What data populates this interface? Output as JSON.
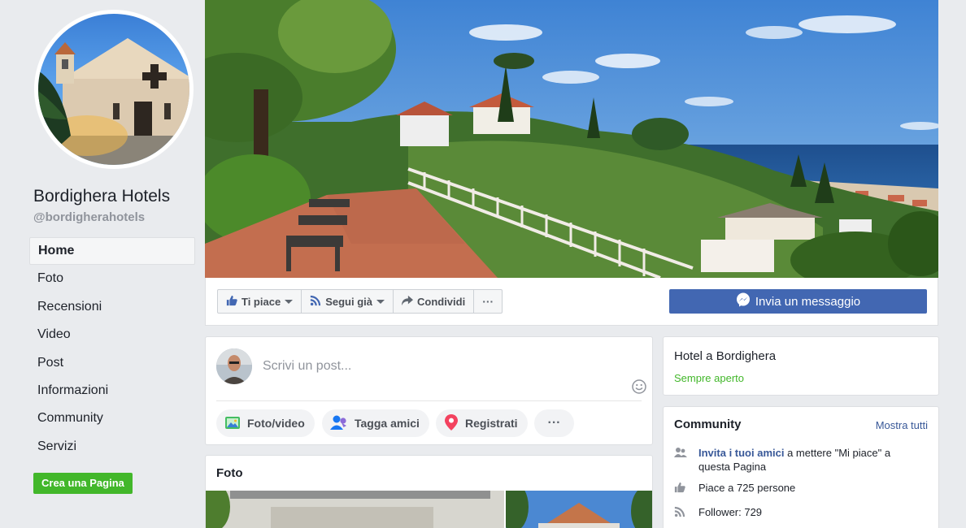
{
  "page": {
    "name": "Bordighera Hotels",
    "handle": "@bordigherahotels"
  },
  "nav": {
    "items": [
      {
        "label": "Home",
        "active": true
      },
      {
        "label": "Foto"
      },
      {
        "label": "Recensioni"
      },
      {
        "label": "Video"
      },
      {
        "label": "Post"
      },
      {
        "label": "Informazioni"
      },
      {
        "label": "Community"
      },
      {
        "label": "Servizi"
      }
    ],
    "create_page": "Crea una Pagina"
  },
  "actions": {
    "like": "Ti piace",
    "follow": "Segui già",
    "share": "Condividi",
    "more": "···",
    "message": "Invia un messaggio"
  },
  "composer": {
    "placeholder": "Scrivi un post...",
    "photo_video": "Foto/video",
    "tag_friends": "Tagga amici",
    "check_in": "Registrati",
    "more": "···"
  },
  "photos": {
    "title": "Foto"
  },
  "about": {
    "category": "Hotel a Bordighera",
    "status": "Sempre aperto"
  },
  "community": {
    "title": "Community",
    "see_all": "Mostra tutti",
    "invite_link": "Invita i tuoi amici",
    "invite_text": " a mettere \"Mi piace\" a questa Pagina",
    "likes": "Piace a 725 persone",
    "followers": "Follower: 729"
  },
  "colors": {
    "primary": "#4267b2",
    "green": "#42b72a",
    "link": "#385898",
    "background": "#e9ebee"
  }
}
